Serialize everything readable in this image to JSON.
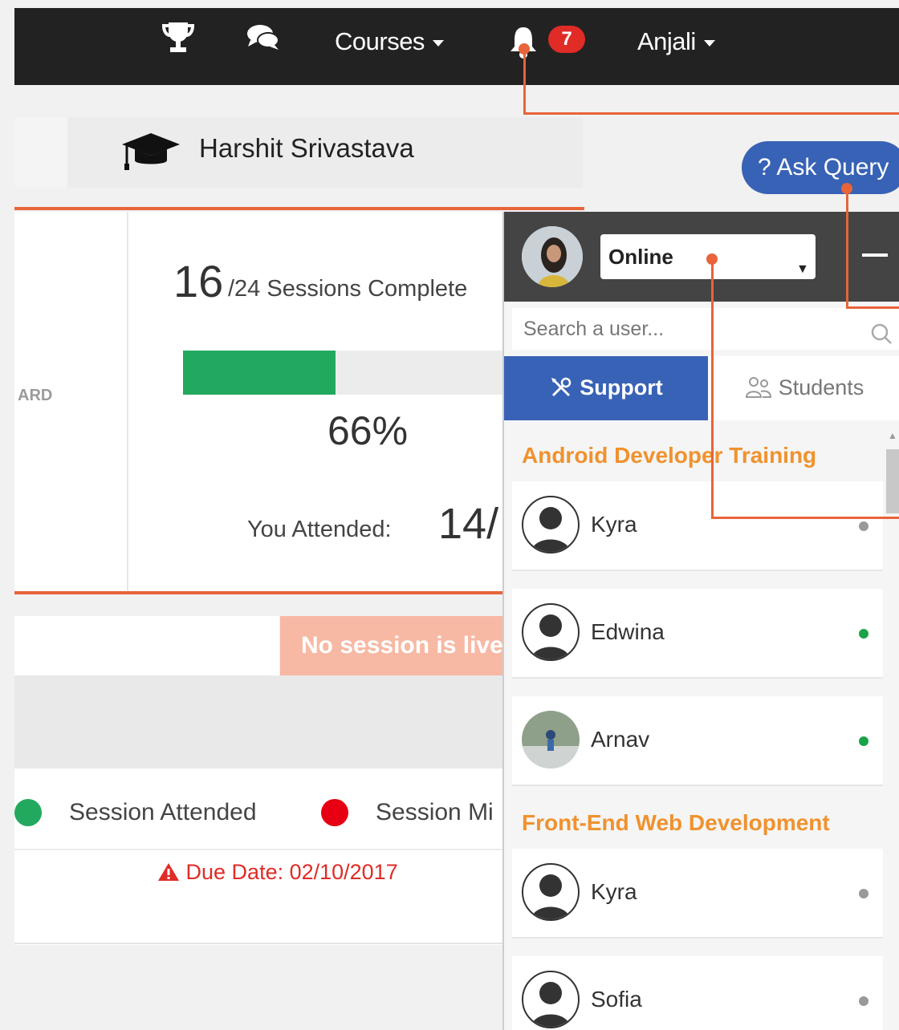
{
  "navbar": {
    "icons": [
      "trophy-icon",
      "chat-icon",
      "bell-icon"
    ],
    "courses_label": "Courses",
    "notification_count": "7",
    "user_label": "Anjali"
  },
  "profile": {
    "student_name": "Harshit Srivastava",
    "icon": "graduation-cap-icon"
  },
  "ask_query_label": "? Ask Query",
  "stats": {
    "dashboard_label": "ARD",
    "sessions_completed": "16",
    "sessions_text": "/24 Sessions Complete",
    "progress_percent": 66,
    "percent_label": "66%",
    "attended_label": "You Attended:",
    "attended_value": "14/"
  },
  "live_banner": "No session is live",
  "legend": {
    "attended": "Session Attended",
    "missed": "Session Mi"
  },
  "due_date": "Due Date: 02/10/2017",
  "colors": {
    "accent": "#e8643a",
    "attended": "#23a95f",
    "missed": "#e60012",
    "primary": "#3862b5",
    "group_title": "#f0922e"
  },
  "chat": {
    "status": "Online",
    "search_placeholder": "Search a user...",
    "tabs": {
      "support": "Support",
      "students": "Students"
    },
    "groups": [
      {
        "title": "Android Developer Training",
        "users": [
          {
            "name": "Kyra",
            "status": "offline"
          },
          {
            "name": "Edwina",
            "status": "online"
          },
          {
            "name": "Arnav",
            "status": "online"
          }
        ]
      },
      {
        "title": "Front-End Web Development",
        "users": [
          {
            "name": "Kyra",
            "status": "offline"
          },
          {
            "name": "Sofia",
            "status": "offline"
          }
        ]
      }
    ]
  }
}
